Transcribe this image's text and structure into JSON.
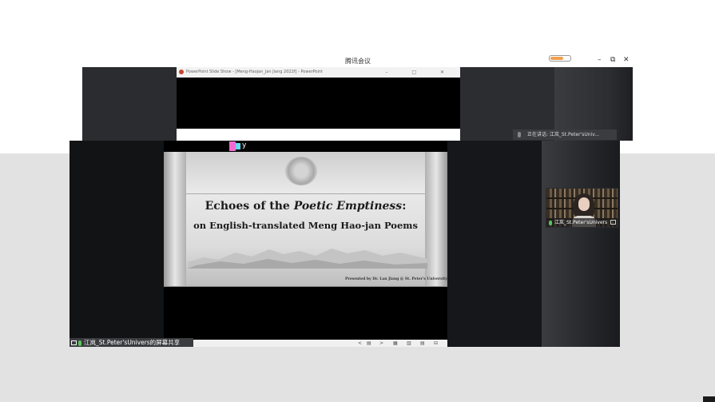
{
  "meeting_window": {
    "title": "腾讯会议",
    "controls": {
      "minimize": "–",
      "restore": "⧉",
      "close": "✕"
    }
  },
  "ppt_window": {
    "title": "PowerPoint Slide Show - [Meng-Haojan_Jan Jiang 2022f] - PowerPoint",
    "controls": "–  □  ✕"
  },
  "speaker_bar": {
    "text": "正在讲话: 江岚_St.Peter'sUniv..."
  },
  "slide": {
    "title_prefix": "Echoes of the ",
    "title_emph": "Poetic Emptiness",
    "title_suffix": ":",
    "subtitle": "on English-translated Meng Hao-jan Poems",
    "presenter": "Presented by Dr. Lan Jiang @ St. Peter's University"
  },
  "ppt_statusbar": {
    "prev": "<",
    "slide_icon": "▤",
    "next": ">",
    "view1": "▦",
    "view2": "▥",
    "view3": "▤",
    "view4": "⊟"
  },
  "share_label": {
    "text": "江岚_St.Peter'sUnivers的屏幕共享"
  },
  "video_tile": {
    "name": "江岚_St.Peter'sUnivers"
  },
  "colors": {
    "background": "#e2e2e2",
    "dark_panel": "#121416",
    "mic_active": "#5ac35a"
  }
}
